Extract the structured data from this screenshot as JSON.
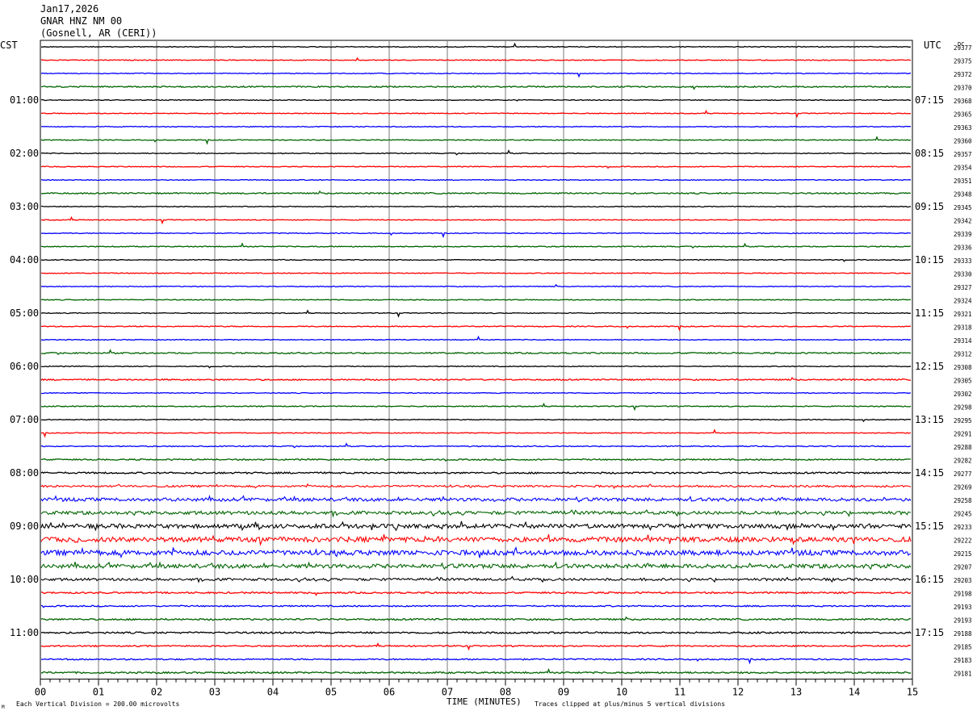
{
  "header": {
    "date": "Jan17,2026",
    "station": "GNAR HNZ NM 00",
    "location": "(Gosnell, AR (CERI))"
  },
  "left_label": "CST",
  "right_label": "UTC",
  "dc_label": "DC",
  "left_times": [
    "01:00",
    "02:00",
    "03:00",
    "04:00",
    "05:00",
    "06:00",
    "07:00",
    "08:00",
    "09:00",
    "10:00",
    "11:00"
  ],
  "right_times": [
    "07:15",
    "08:15",
    "09:15",
    "10:15",
    "11:15",
    "12:15",
    "13:15",
    "14:15",
    "15:15",
    "16:15",
    "17:15"
  ],
  "x_ticks": [
    "00",
    "01",
    "02",
    "03",
    "04",
    "05",
    "06",
    "07",
    "08",
    "09",
    "10",
    "11",
    "12",
    "13",
    "14",
    "15"
  ],
  "xlabel": "TIME (MINUTES)",
  "footer_left": "Each Vertical Division =  200.00 microvolts",
  "footer_right": "Traces clipped at plus/minus 5 vertical divisions",
  "corner_mark": "M",
  "trace_colors": [
    "#000000",
    "#ff0000",
    "#0000ff",
    "#006400"
  ],
  "chart_data": {
    "type": "line",
    "x_range": [
      0,
      15
    ],
    "trace_count": 48,
    "dc_offsets": [
      29377,
      29375,
      29372,
      29370,
      29368,
      29365,
      29363,
      29360,
      29357,
      29354,
      29351,
      29348,
      29345,
      29342,
      29339,
      29336,
      29333,
      29330,
      29327,
      29324,
      29321,
      29318,
      29314,
      29312,
      29308,
      29305,
      29302,
      29298,
      29295,
      29291,
      29288,
      29282,
      29277,
      29269,
      29258,
      29245,
      29233,
      29222,
      29215,
      29207,
      29203,
      29198,
      29193,
      29193,
      29188,
      29185,
      29183,
      29181
    ],
    "noise_level": [
      0.5,
      0.5,
      0.5,
      0.8,
      0.5,
      0.5,
      0.5,
      0.5,
      0.5,
      0.5,
      0.5,
      0.8,
      0.5,
      0.5,
      0.5,
      0.6,
      0.5,
      0.5,
      0.5,
      0.5,
      0.5,
      0.6,
      0.5,
      0.8,
      0.5,
      0.8,
      0.5,
      0.6,
      0.5,
      0.5,
      0.6,
      0.8,
      1.0,
      1.2,
      2.0,
      2.0,
      2.5,
      3.0,
      3.0,
      2.5,
      1.5,
      1.0,
      0.8,
      1.0,
      1.0,
      0.8,
      0.8,
      1.0
    ]
  }
}
